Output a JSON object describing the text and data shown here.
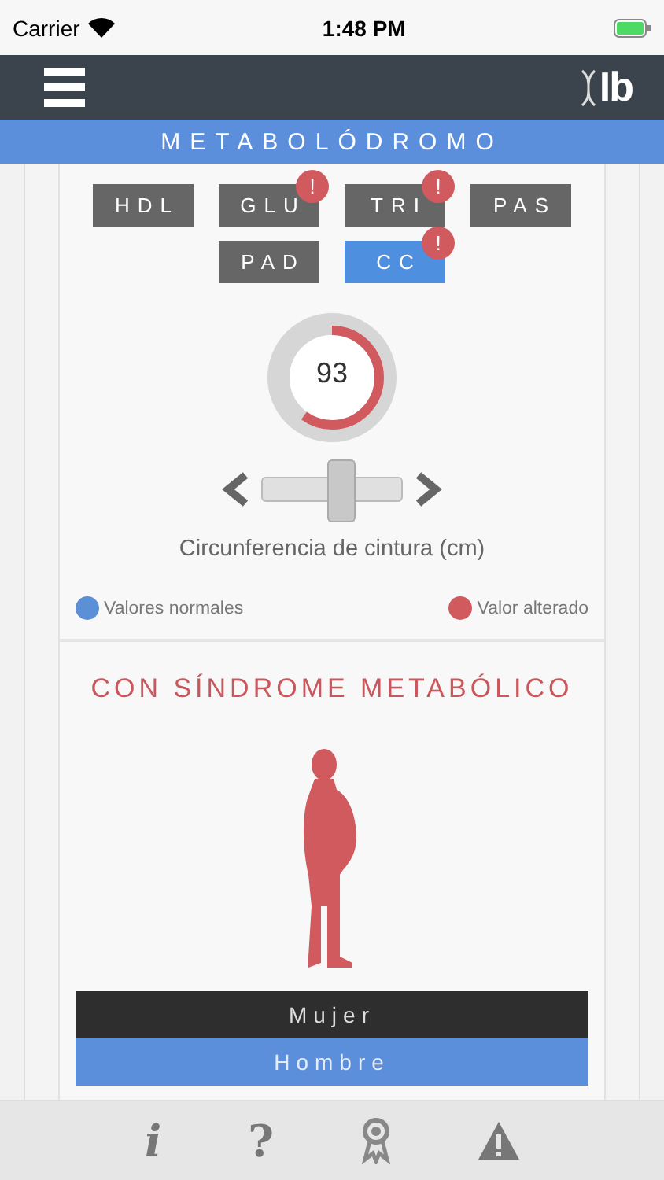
{
  "status_bar": {
    "carrier": "Carrier",
    "time": "1:48 PM"
  },
  "header": {
    "logo": "Ib"
  },
  "title": "METABOLÓDROMO",
  "tabs": [
    {
      "label": "HDL",
      "selected": false,
      "alert": false
    },
    {
      "label": "GLU",
      "selected": false,
      "alert": true
    },
    {
      "label": "TRI",
      "selected": false,
      "alert": true
    },
    {
      "label": "PAS",
      "selected": false,
      "alert": false
    },
    {
      "label": "PAD",
      "selected": false,
      "alert": false
    },
    {
      "label": "CC",
      "selected": true,
      "alert": true
    }
  ],
  "alert_mark": "!",
  "gauge": {
    "value": "93",
    "level": 0.6,
    "color": "#d05a5e"
  },
  "slider": {
    "level": 0.55,
    "label": "Circunferencia de cintura (cm)"
  },
  "legend": [
    {
      "label": "Valores normales",
      "color": "#5b8fd6"
    },
    {
      "label": "Valor alterado",
      "color": "#d05a5e"
    }
  ],
  "result": {
    "title": "CON SÍNDROME METABÓLICO"
  },
  "sex_options": [
    {
      "label": "Mujer",
      "selected": false
    },
    {
      "label": "Hombre",
      "selected": true
    }
  ],
  "bottom_bar": [
    {
      "kind": "text",
      "glyph": "i"
    },
    {
      "kind": "text",
      "glyph": "?"
    },
    {
      "kind": "award"
    },
    {
      "kind": "warning"
    }
  ]
}
